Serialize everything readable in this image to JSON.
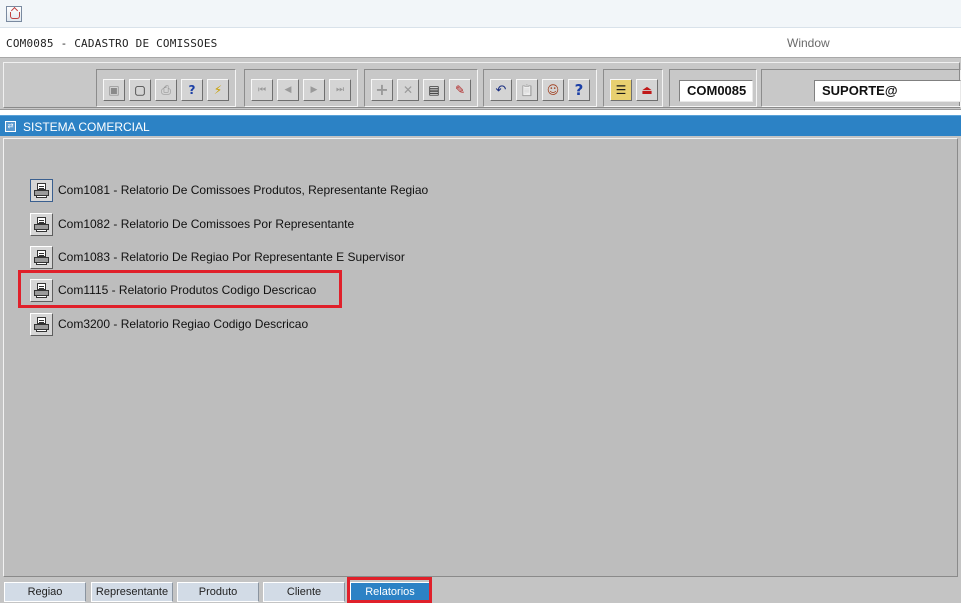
{
  "window": {
    "title": "COM0085 - CADASTRO DE COMISSOES",
    "menu_window": "Window"
  },
  "toolbar": {
    "groups": [
      {
        "name": "record",
        "buttons": [
          {
            "icon": "save-icon",
            "glyph": "▣",
            "enabled": false
          },
          {
            "icon": "monitor-icon",
            "glyph": "▢",
            "enabled": true
          },
          {
            "icon": "print-icon",
            "glyph": "⎙",
            "enabled": false
          },
          {
            "icon": "query-help-icon",
            "glyph": "?",
            "enabled": true
          },
          {
            "icon": "execute-query-icon",
            "glyph": "⚡",
            "enabled": true
          }
        ]
      },
      {
        "name": "navigation",
        "buttons": [
          {
            "icon": "first-record-icon",
            "glyph": "⏮",
            "enabled": false
          },
          {
            "icon": "previous-record-icon",
            "glyph": "◀",
            "enabled": false
          },
          {
            "icon": "next-record-icon",
            "glyph": "▶",
            "enabled": false
          },
          {
            "icon": "last-record-icon",
            "glyph": "⏭",
            "enabled": false
          }
        ]
      },
      {
        "name": "edit",
        "buttons": [
          {
            "icon": "insert-record-icon",
            "glyph": "+",
            "enabled": false
          },
          {
            "icon": "delete-record-icon",
            "glyph": "✕",
            "enabled": false
          },
          {
            "icon": "lov-icon",
            "glyph": "▤",
            "enabled": true
          },
          {
            "icon": "edit-icon",
            "glyph": "✎",
            "enabled": true
          }
        ]
      },
      {
        "name": "tools",
        "buttons": [
          {
            "icon": "undo-icon",
            "glyph": "↶",
            "enabled": true
          },
          {
            "icon": "clipboard-icon",
            "glyph": "📋",
            "enabled": false
          },
          {
            "icon": "users-icon",
            "glyph": "☺",
            "enabled": true
          },
          {
            "icon": "help-icon",
            "glyph": "?",
            "enabled": true
          }
        ]
      },
      {
        "name": "menu",
        "buttons": [
          {
            "icon": "menu-icon",
            "glyph": "☰",
            "enabled": true
          },
          {
            "icon": "exit-icon",
            "glyph": "⏏",
            "enabled": true
          }
        ]
      }
    ],
    "form_code": "COM0085",
    "user": "SUPORTE@"
  },
  "section": {
    "title": "SISTEMA COMERCIAL"
  },
  "reports": [
    {
      "label": "Com1081 - Relatorio De Comissoes Produtos, Representante Regiao"
    },
    {
      "label": "Com1082 - Relatorio De Comissoes Por Representante"
    },
    {
      "label": "Com1083 - Relatorio De Regiao Por Representante E Supervisor"
    },
    {
      "label": "Com1115 - Relatorio Produtos Codigo Descricao"
    },
    {
      "label": "Com3200 - Relatorio Regiao Codigo Descricao"
    }
  ],
  "tabs": [
    {
      "label": "Regiao",
      "active": false
    },
    {
      "label": "Representante",
      "active": false
    },
    {
      "label": "Produto",
      "active": false
    },
    {
      "label": "Cliente",
      "active": false
    },
    {
      "label": "Relatorios",
      "active": true
    }
  ],
  "colors": {
    "section_header": "#2c82c5",
    "highlight": "#e0202a",
    "panel": "#bdbdbd"
  }
}
